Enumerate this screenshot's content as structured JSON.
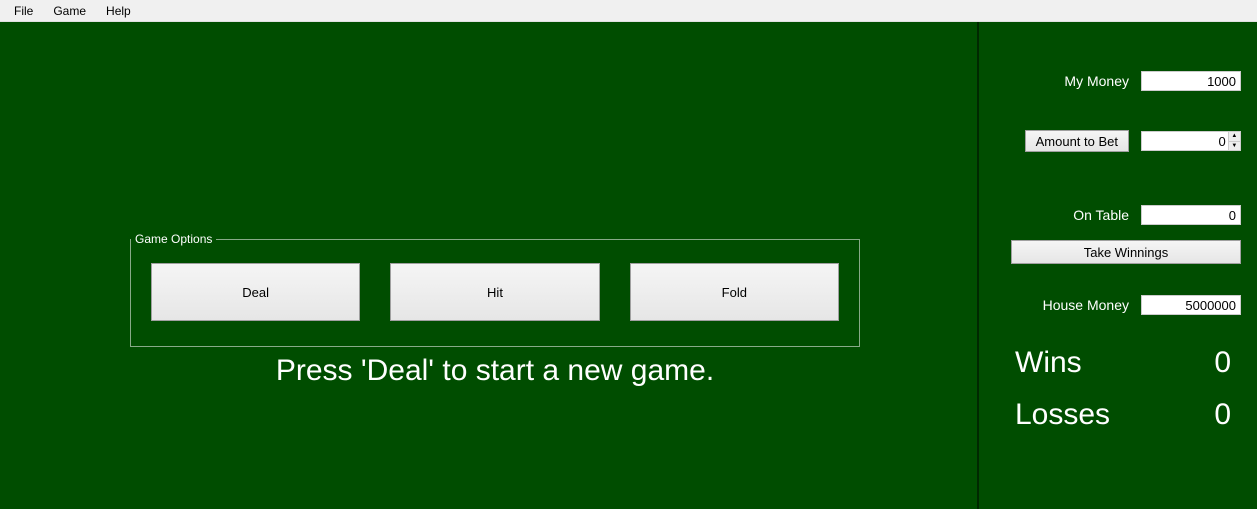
{
  "menubar": {
    "file": "File",
    "game": "Game",
    "help": "Help"
  },
  "game_options": {
    "legend": "Game Options",
    "deal": "Deal",
    "hit": "Hit",
    "fold": "Fold"
  },
  "instruction": "Press 'Deal' to start a new game.",
  "sidebar": {
    "my_money_label": "My Money",
    "my_money_value": "1000",
    "amount_to_bet_label": "Amount to Bet",
    "amount_to_bet_value": "0",
    "on_table_label": "On Table",
    "on_table_value": "0",
    "take_winnings": "Take Winnings",
    "house_money_label": "House Money",
    "house_money_value": "5000000",
    "wins_label": "Wins",
    "wins_value": "0",
    "losses_label": "Losses",
    "losses_value": "0"
  }
}
